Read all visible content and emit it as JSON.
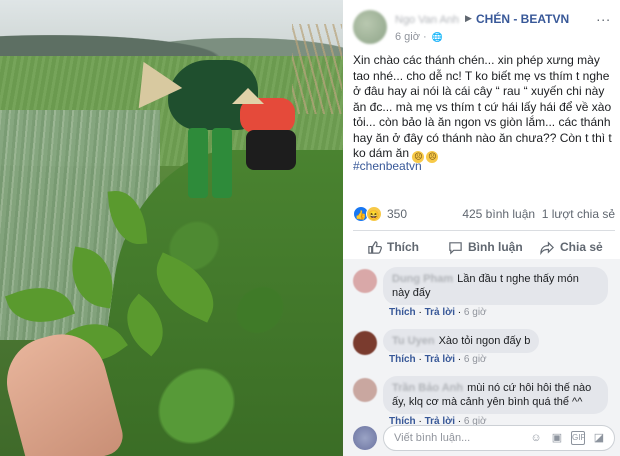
{
  "post": {
    "author": "Ngo Van Anh",
    "group": "CHÉN - BEATVN",
    "time": "6 giờ",
    "more": "...",
    "text": "Xin chào các thánh chén... xin phép xưng mày tao nhé... cho dễ nc! T ko biết mẹ vs thím t nghe ở đâu hay ai nói là cái cây “ rau “ xuyến chi này ăn đc... mà mẹ vs thím t cứ hái lấy hái để về xào tỏi... còn bảo là ăn ngon vs giòn lắm... các thánh hay ăn ở đây có thánh nào ăn chưa?? Còn t thì t ko dám ăn",
    "hashtag": "#chenbeatvn"
  },
  "stats": {
    "reaction_count": "350",
    "comments_shares": "425 bình luận  1 lượt chia sẻ"
  },
  "actions": {
    "like": "Thích",
    "comment": "Bình luận",
    "share": "Chia sẻ"
  },
  "comments": [
    {
      "name": "Dung Pham",
      "text": "Lần đầu t nghe thấy món này đấy",
      "like": "Thích",
      "reply": "Trả lời",
      "time": "6 giờ",
      "avatar_color": "#d9a8a8"
    },
    {
      "name": "Tu Uyen",
      "text": "Xào tỏi ngon đấy b",
      "like": "Thích",
      "reply": "Trả lời",
      "time": "6 giờ",
      "avatar_color": "#7a3b2e"
    },
    {
      "name": "Trần Bảo Anh",
      "text": "mùi nó cứ hôi hôi thế nào ấy, klq cơ mà cảnh yên bình quá thể ^^",
      "like": "Thích",
      "reply": "Trả lời",
      "time": "6 giờ",
      "avatar_color": "#c9a7a0"
    }
  ],
  "composer": {
    "placeholder": "Viết bình luận..."
  },
  "colors": {
    "link": "#385898",
    "like_blue": "#1877f2",
    "muted": "#606770"
  }
}
